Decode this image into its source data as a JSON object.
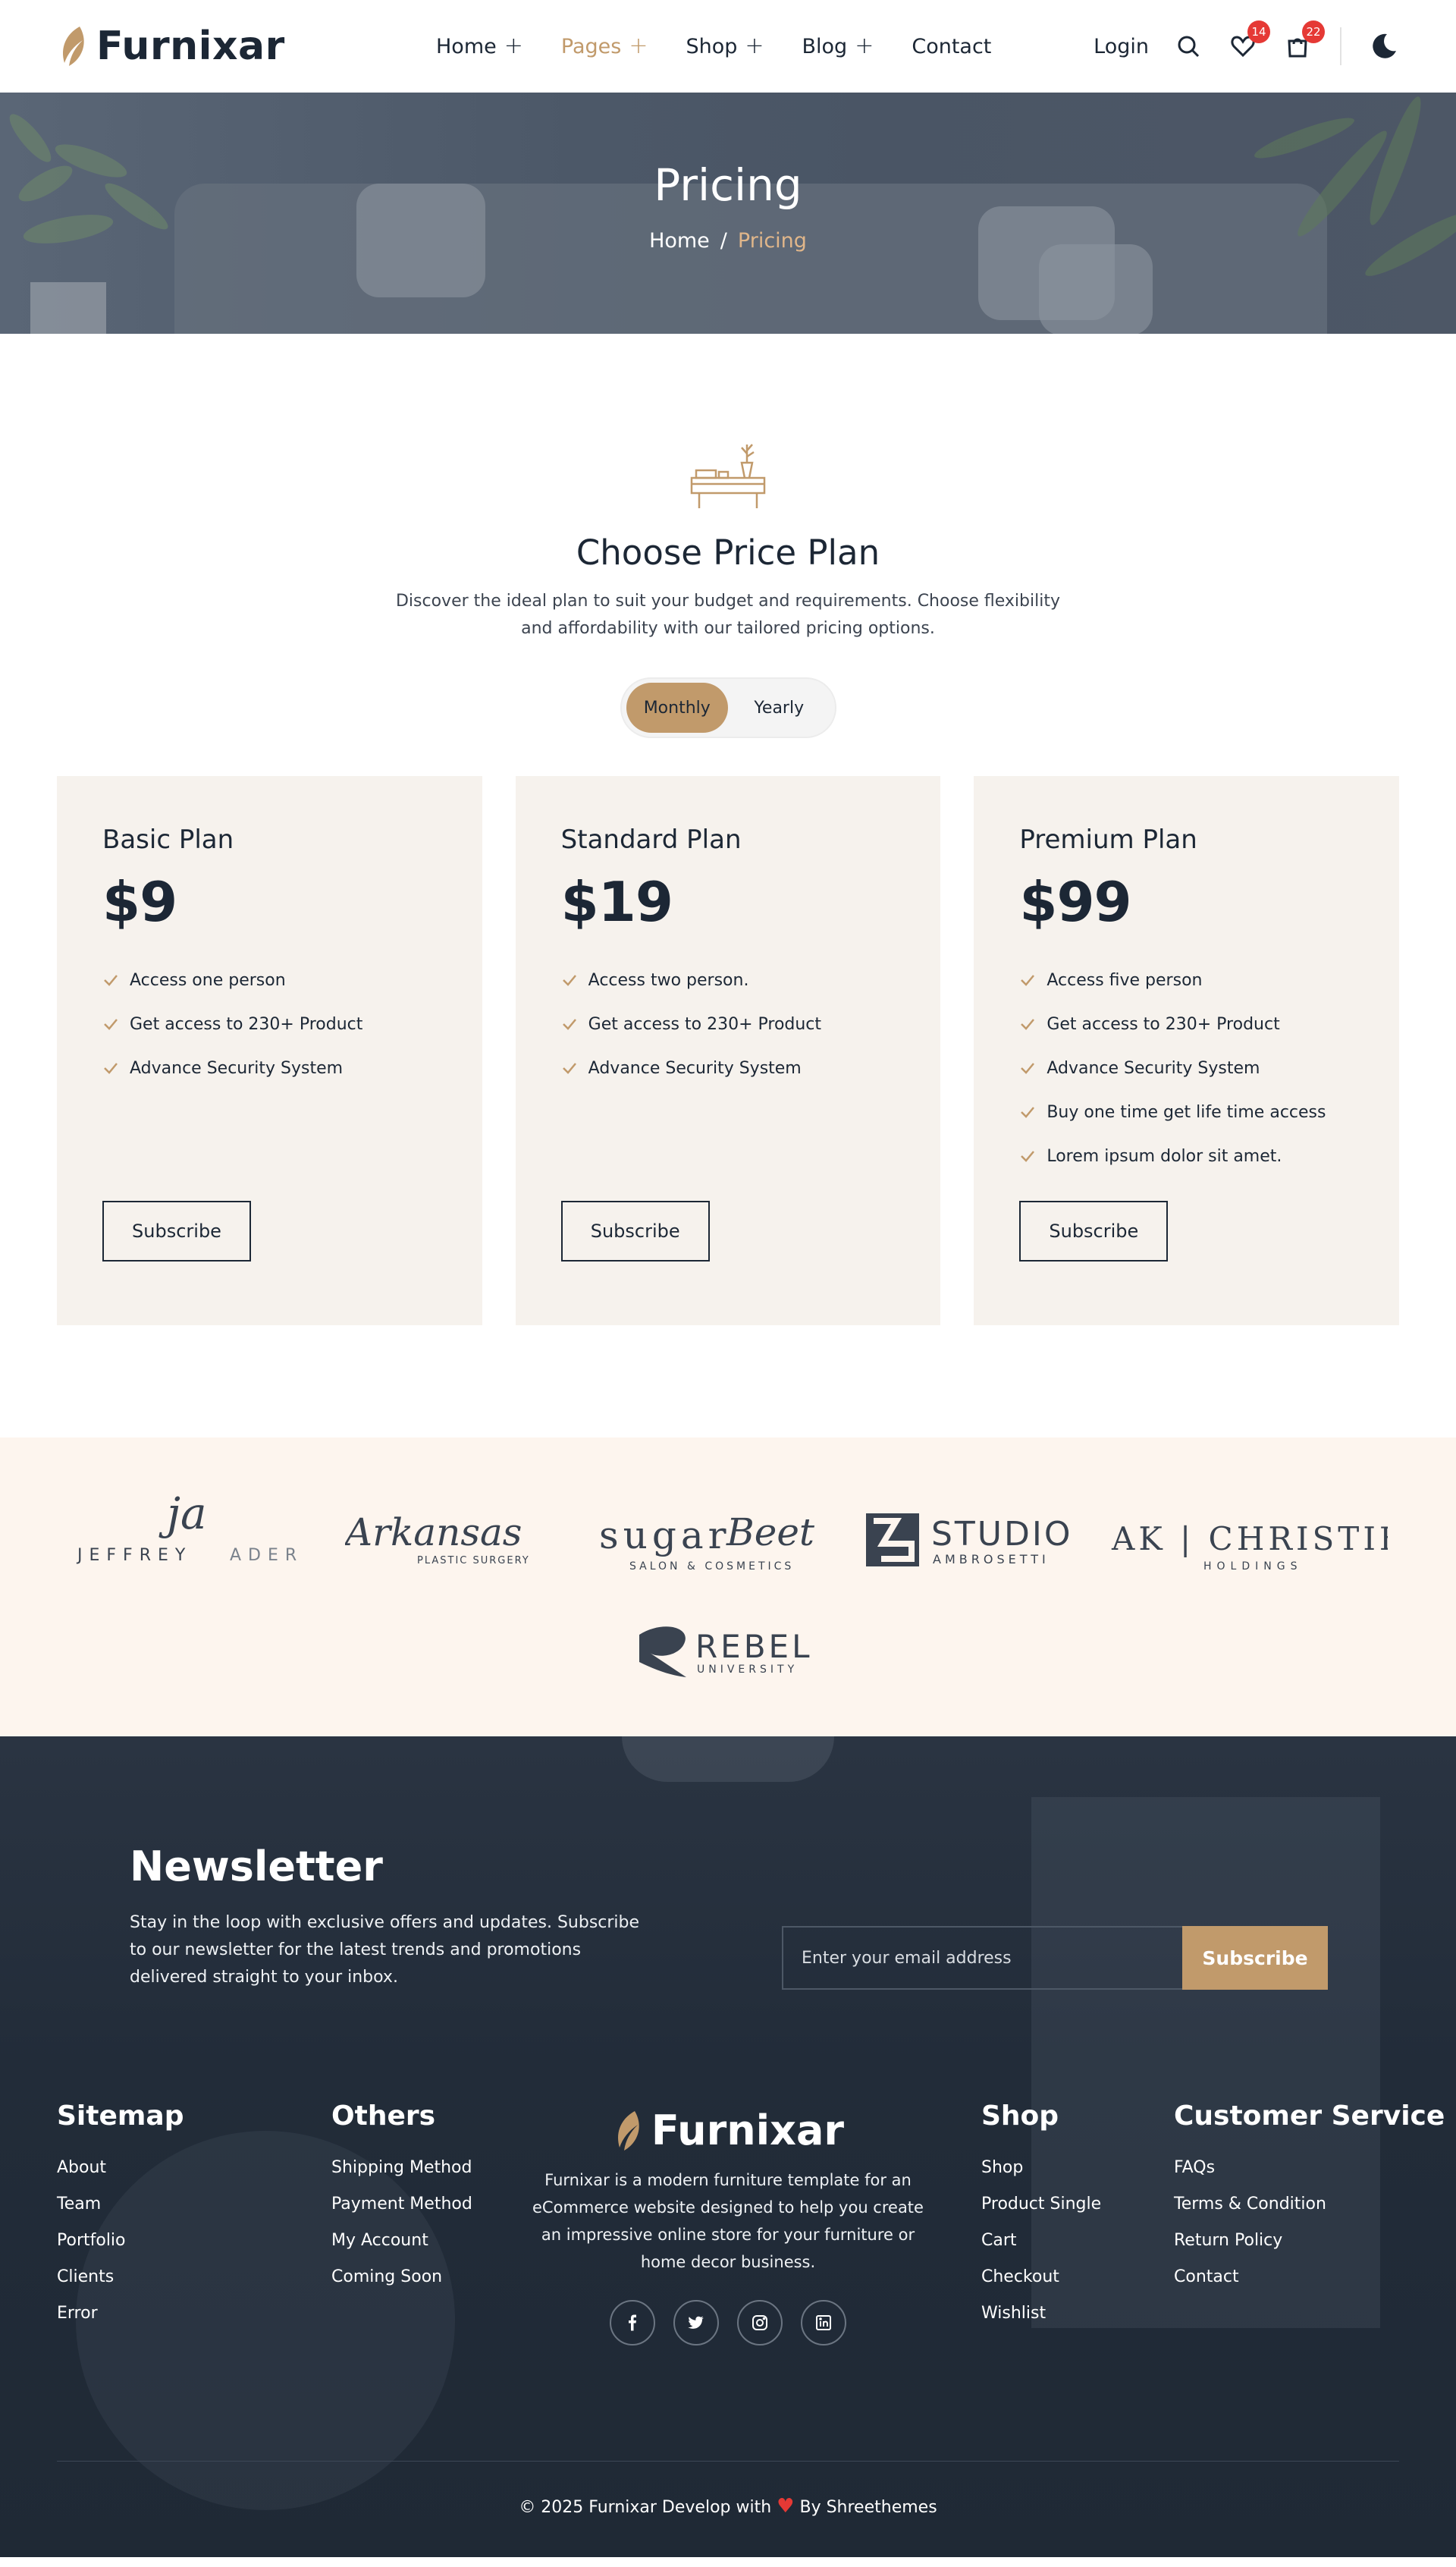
{
  "brand": {
    "name": "Furnixar"
  },
  "nav": {
    "items": [
      {
        "label": "Home",
        "has_sub": true,
        "active": false
      },
      {
        "label": "Pages",
        "has_sub": true,
        "active": true
      },
      {
        "label": "Shop",
        "has_sub": true,
        "active": false
      },
      {
        "label": "Blog",
        "has_sub": true,
        "active": false
      },
      {
        "label": "Contact",
        "has_sub": false,
        "active": false
      }
    ],
    "login": "Login",
    "wishlist_count": "14",
    "cart_count": "22",
    "plus": "+"
  },
  "hero": {
    "title": "Pricing",
    "breadcrumb": {
      "home": "Home",
      "separator": "/",
      "current": "Pricing"
    }
  },
  "pricing": {
    "title": "Choose Price Plan",
    "description": "Discover the ideal plan to suit your budget and requirements. Choose flexibility and affordability with our tailored pricing options.",
    "toggle": {
      "monthly": "Monthly",
      "yearly": "Yearly",
      "selected": "Monthly"
    },
    "plans": [
      {
        "name": "Basic Plan",
        "price": "$9",
        "features": [
          "Access one person",
          "Get access to 230+ Product",
          "Advance Security System"
        ],
        "button": "Subscribe"
      },
      {
        "name": "Standard Plan",
        "price": "$19",
        "features": [
          "Access two person.",
          "Get access to 230+ Product",
          "Advance Security System"
        ],
        "button": "Subscribe"
      },
      {
        "name": "Premium Plan",
        "price": "$99",
        "features": [
          "Access five person",
          "Get access to 230+ Product",
          "Advance Security System",
          "Buy one time get life time access",
          "Lorem ipsum dolor sit amet."
        ],
        "button": "Subscribe"
      }
    ]
  },
  "brands": {
    "jeffrey": {
      "mark": "ja",
      "name_left": "JEFFREY",
      "name_right": "ADER"
    },
    "arkansas": {
      "name": "Arkansas",
      "sub": "PLASTIC SURGERY"
    },
    "sugarbeet": {
      "name_a": "sugar",
      "name_b": "Beet",
      "sub": "SALON & COSMETICS"
    },
    "studio": {
      "name": "STUDIO",
      "sub": "AMBROSETTI"
    },
    "christie": {
      "name": "AK | CHRISTIE",
      "sub": "HOLDINGS"
    },
    "rebel": {
      "name": "REBEL",
      "sub": "UNIVERSITY"
    }
  },
  "newsletter": {
    "title": "Newsletter",
    "description": "Stay in the loop with exclusive offers and updates. Subscribe to our newsletter for the latest trends and promotions delivered straight to your inbox.",
    "placeholder": "Enter your email address",
    "button": "Subscribe"
  },
  "footer": {
    "sitemap": {
      "title": "Sitemap",
      "links": [
        "About",
        "Team",
        "Portfolio",
        "Clients",
        "Error"
      ]
    },
    "others": {
      "title": "Others",
      "links": [
        "Shipping Method",
        "Payment Method",
        "My Account",
        "Coming Soon"
      ]
    },
    "about": "Furnixar is a modern furniture template for an eCommerce website designed to help you create an impressive online store for your furniture or home decor business.",
    "shop": {
      "title": "Shop",
      "links": [
        "Shop",
        "Product Single",
        "Cart",
        "Checkout",
        "Wishlist"
      ]
    },
    "service": {
      "title": "Customer Service",
      "links": [
        "FAQs",
        "Terms & Condition",
        "Return Policy",
        "Contact"
      ]
    },
    "socials": [
      "facebook-icon",
      "twitter-icon",
      "instagram-icon",
      "linkedin-icon"
    ],
    "copyright_pre": "© 2025 Furnixar Develop with",
    "copyright_post": "By Shreethemes"
  },
  "colors": {
    "accent": "#c19a6b",
    "dark": "#1c2735",
    "badge": "#e53935",
    "card": "#f6f2ed",
    "brands_bg": "#fdf5ee"
  }
}
